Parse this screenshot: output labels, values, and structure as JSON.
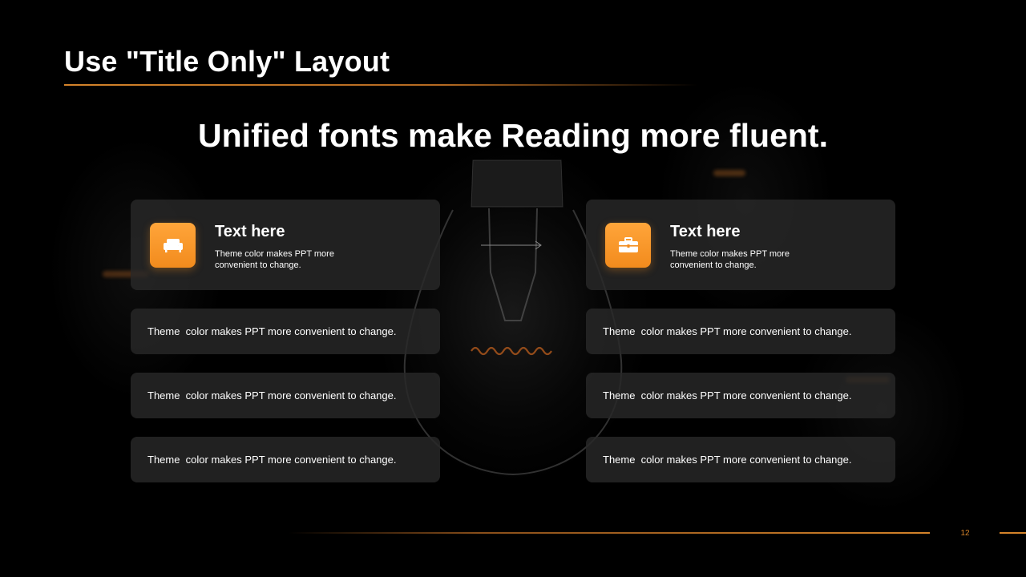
{
  "slide": {
    "title": "Use \"Title Only\" Layout",
    "subtitle": "Unified fonts make Reading more fluent.",
    "page_number": "12"
  },
  "colors": {
    "accent": "#f28b1d",
    "background": "#000000",
    "card": "#282828",
    "text": "#ffffff"
  },
  "left_panel": {
    "icon": "sofa-icon",
    "heading": "Text here",
    "description": "Theme  color makes PPT more convenient to change.",
    "rows": [
      "Theme  color makes PPT more convenient to change.",
      "Theme  color makes PPT more convenient to change.",
      "Theme  color makes PPT more convenient to change."
    ]
  },
  "right_panel": {
    "icon": "briefcase-icon",
    "heading": "Text here",
    "description": "Theme  color makes PPT more convenient to change.",
    "rows": [
      "Theme  color makes PPT more convenient to change.",
      "Theme  color makes PPT more convenient to change.",
      "Theme  color makes PPT more convenient to change."
    ]
  },
  "connector": {
    "icon": "arrow-right-icon"
  }
}
